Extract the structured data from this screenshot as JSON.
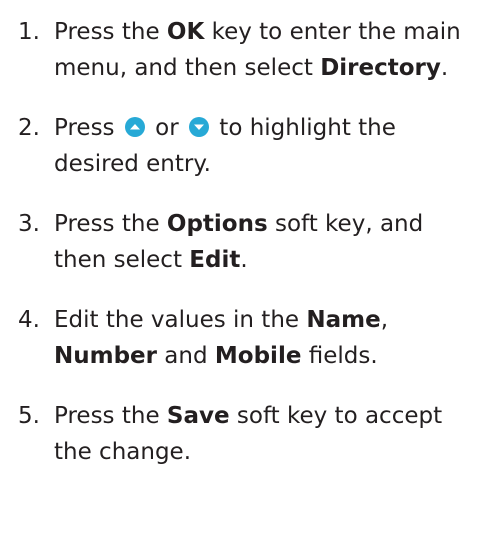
{
  "colors": {
    "text": "#231f20",
    "key_icon_fill": "#27a9d6",
    "key_icon_arrow": "#ffffff"
  },
  "steps": [
    {
      "num": "1.",
      "t1": "Press the ",
      "b1": "OK",
      "t2": " key to enter the main menu, and then select ",
      "b2": "Directory",
      "t3": "."
    },
    {
      "num": "2.",
      "t1": "Press ",
      "icon1": "arrow-up-key-icon",
      "t2": " or ",
      "icon2": "arrow-down-key-icon",
      "t3": " to highlight the desired entry."
    },
    {
      "num": "3.",
      "t1": "Press the ",
      "b1": "Options",
      "t2": " soft key, and then select ",
      "b2": "Edit",
      "t3": "."
    },
    {
      "num": "4.",
      "t1": "Edit the values in the ",
      "b1": "Name",
      "t2": ", ",
      "b2": "Number",
      "t3": " and ",
      "b3": "Mobile",
      "t4": " fields."
    },
    {
      "num": "5.",
      "t1": "Press the ",
      "b1": "Save",
      "t2": " soft key to accept the change."
    }
  ]
}
